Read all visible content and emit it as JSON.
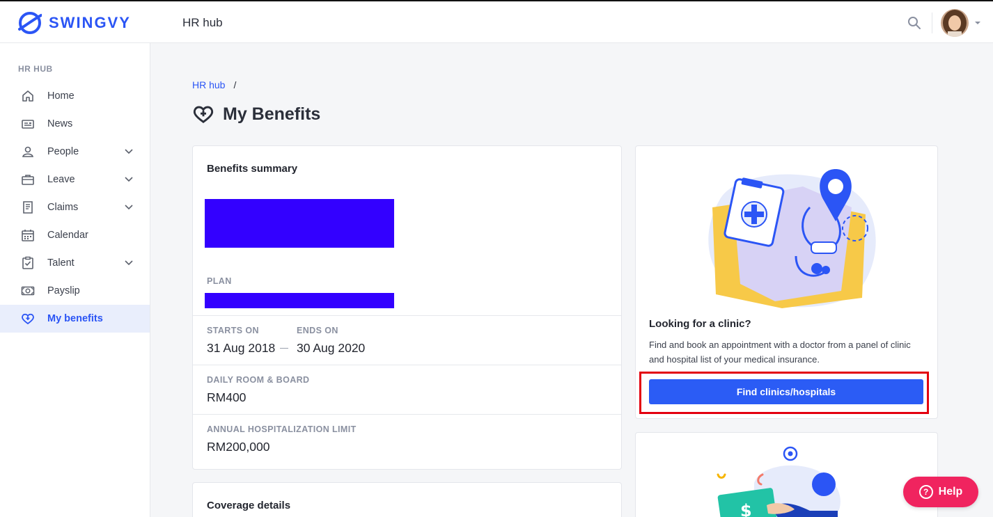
{
  "header": {
    "logo_text": "SWINGVY",
    "app_title": "HR hub",
    "icons": {
      "search": "search-icon",
      "avatar": "user-avatar",
      "caret": "chevron-down-icon"
    }
  },
  "sidebar": {
    "heading": "HR HUB",
    "items": [
      {
        "label": "Home",
        "icon": "home-icon",
        "has_submenu": false
      },
      {
        "label": "News",
        "icon": "newspaper-icon",
        "has_submenu": false
      },
      {
        "label": "People",
        "icon": "person-icon",
        "has_submenu": true
      },
      {
        "label": "Leave",
        "icon": "briefcase-icon",
        "has_submenu": true
      },
      {
        "label": "Claims",
        "icon": "receipt-icon",
        "has_submenu": true
      },
      {
        "label": "Calendar",
        "icon": "calendar-icon",
        "has_submenu": false
      },
      {
        "label": "Talent",
        "icon": "clipboard-check-icon",
        "has_submenu": true
      },
      {
        "label": "Payslip",
        "icon": "money-icon",
        "has_submenu": false
      },
      {
        "label": "My benefits",
        "icon": "heart-plus-icon",
        "has_submenu": false,
        "active": true
      }
    ]
  },
  "breadcrumb": {
    "link": "HR hub",
    "separator": "/"
  },
  "page": {
    "title": "My Benefits",
    "icon": "heart-plus-icon"
  },
  "summary": {
    "title": "Benefits summary",
    "plan_label": "PLAN",
    "starts_on_label": "STARTS ON",
    "starts_on": "31 Aug 2018",
    "ends_on_label": "ENDS ON",
    "ends_on": "30 Aug 2020",
    "room_board_label": "DAILY ROOM & BOARD",
    "room_board": "RM400",
    "hosp_limit_label": "ANNUAL HOSPITALIZATION LIMIT",
    "hosp_limit": "RM200,000"
  },
  "coverage": {
    "title": "Coverage details"
  },
  "clinic": {
    "title": "Looking for a clinic?",
    "description": "Find and book an appointment with a doctor from a panel of clinic and hospital list of your medical insurance.",
    "button": "Find clinics/hospitals"
  },
  "help": {
    "label": "Help"
  },
  "colors": {
    "brand": "#2b55f5",
    "redaction": "#3300ff",
    "highlight": "#e3000f",
    "help": "#f0245f"
  }
}
